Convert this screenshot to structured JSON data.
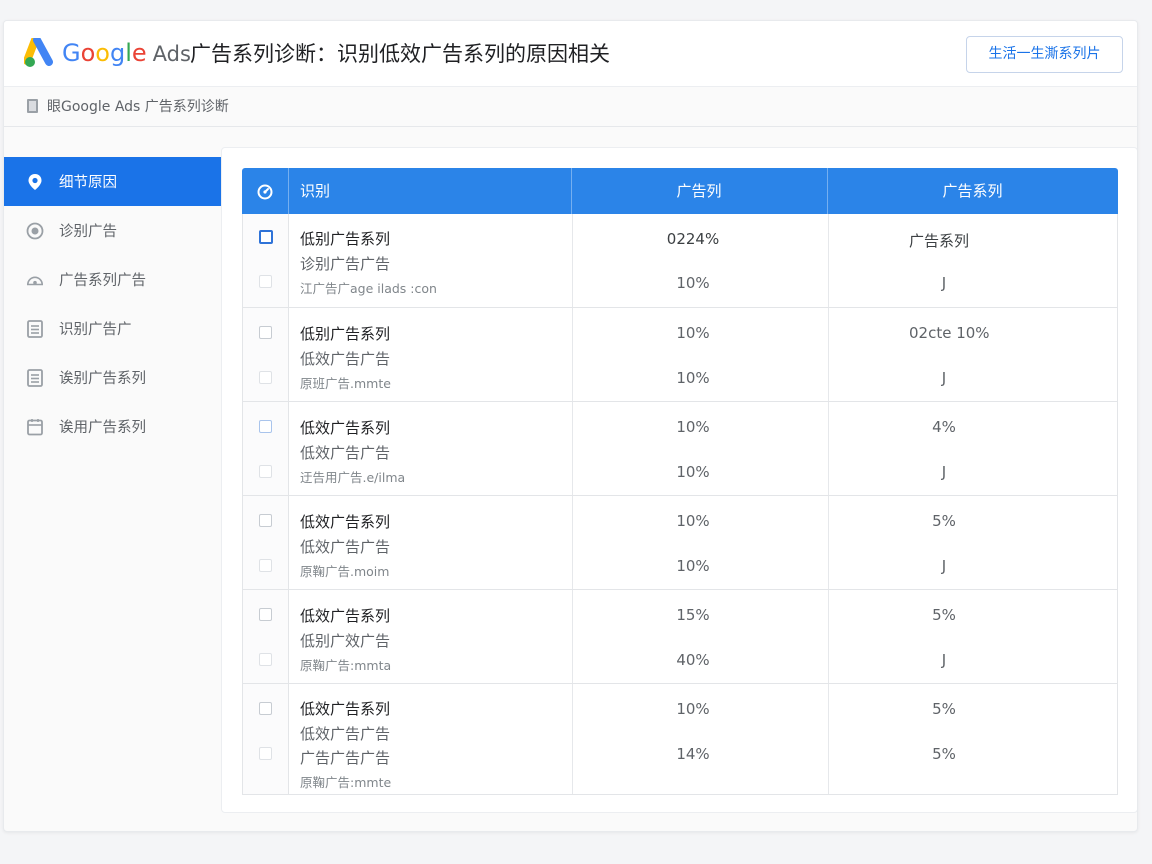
{
  "header": {
    "brand_google": [
      "G",
      "o",
      "o",
      "g",
      "l",
      "e"
    ],
    "brand_ads": "Ads",
    "title": "广告系列诊断：识别低效广告系列的原因相关",
    "action_button": "生活一生澌系列片"
  },
  "breadcrumb": {
    "text": "眼Google Ads 广告系列诊断"
  },
  "sidebar": {
    "items": [
      {
        "label": "细节原因",
        "icon": "location-pin-icon",
        "active": true
      },
      {
        "label": "诊别广告",
        "icon": "eye-icon",
        "active": false
      },
      {
        "label": "广告系列广告",
        "icon": "dashboard-gauge-icon",
        "active": false
      },
      {
        "label": "识别广告广",
        "icon": "list-doc-icon",
        "active": false
      },
      {
        "label": "诶别广告系列",
        "icon": "list-doc-icon",
        "active": false
      },
      {
        "label": "诶用广告系列",
        "icon": "calendar-icon",
        "active": false
      }
    ]
  },
  "table": {
    "columns": [
      "识别",
      "广告列",
      "广告系列"
    ],
    "header_icon": "gauge-icon",
    "rows": [
      {
        "name": "低别广告系列",
        "sub": "诊别广告广告",
        "meta": "江广告广age ilads :con",
        "col2_top": "0224%",
        "col2_bottom": "10%",
        "col3_top": "广告系列",
        "col3_bottom": "J"
      },
      {
        "name": "低别广告系列",
        "sub": "低效广告广告",
        "meta": "原班广告.mmte",
        "col2_top": "10%",
        "col2_bottom": "10%",
        "col3_top": "02cte 10%",
        "col3_bottom": "J"
      },
      {
        "name": "低效广告系列",
        "sub": "低效广告广告",
        "meta": "迂告用广告.e/ilma",
        "col2_top": "10%",
        "col2_bottom": "10%",
        "col3_top": "4%",
        "col3_bottom": "J"
      },
      {
        "name": "低效广告系列",
        "sub": "低效广告广告",
        "meta": "原鞠广告.moim",
        "col2_top": "10%",
        "col2_bottom": "10%",
        "col3_top": "5%",
        "col3_bottom": "J"
      },
      {
        "name": "低效广告系列",
        "sub": "低别广效广告",
        "meta": "原鞠广告:mmta",
        "col2_top": "15%",
        "col2_bottom": "40%",
        "col3_top": "5%",
        "col3_bottom": "J"
      },
      {
        "name": "低效广告系列",
        "sub": "低效广告广告",
        "sub2": "广告广告广告",
        "meta": "原鞠广告:mmte",
        "col2_top": "10%",
        "col2_bottom": "14%",
        "col3_top": "5%",
        "col3_bottom": "5%"
      }
    ]
  },
  "colors": {
    "accent": "#1a73e8",
    "table_header": "#2b84e8"
  }
}
